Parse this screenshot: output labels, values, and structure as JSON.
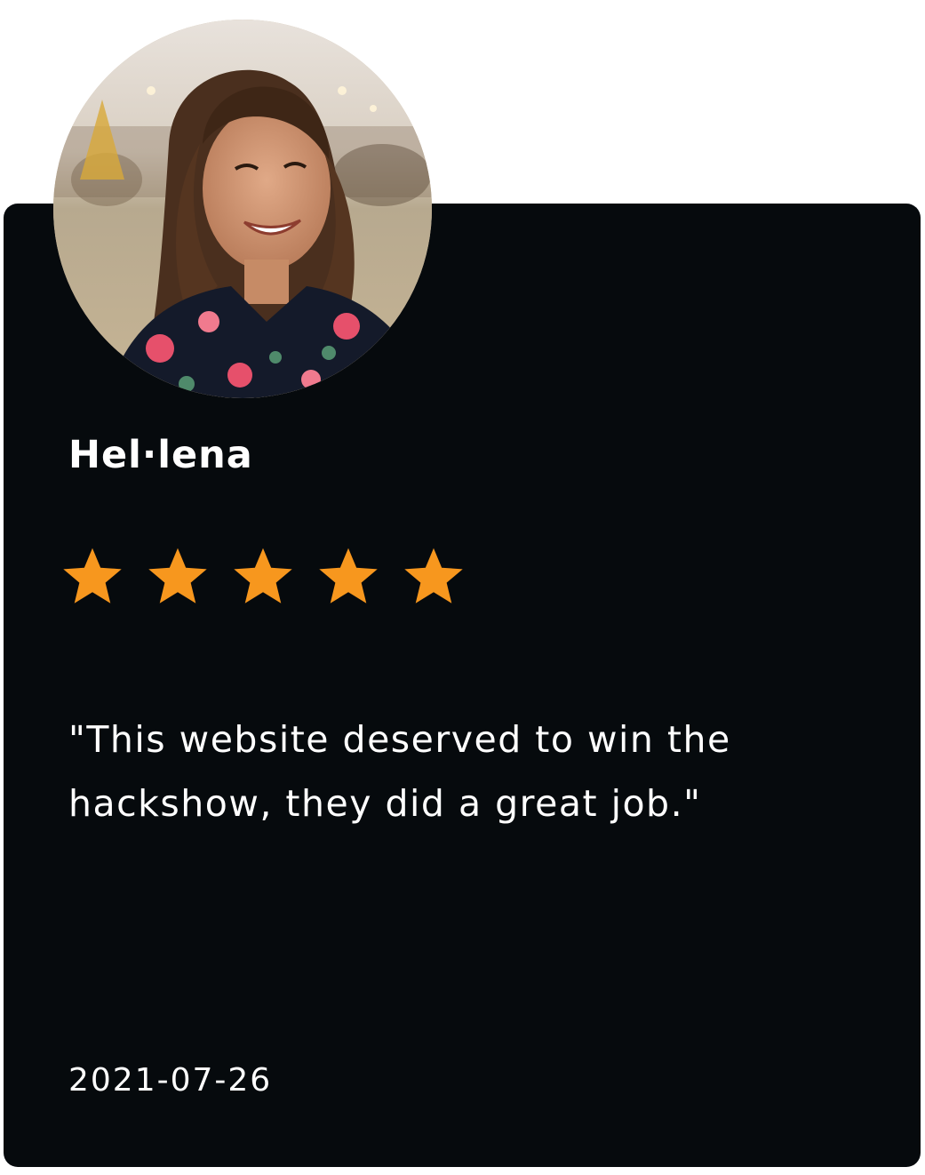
{
  "review": {
    "name": "Hel·lena",
    "rating": 5,
    "rating_max": 5,
    "quote": "\"This website deserved to win the hackshow, they did a great job.\"",
    "date": "2021-07-26"
  },
  "colors": {
    "card_background": "#060a0d",
    "star": "#f7971e",
    "text": "#ffffff"
  },
  "icons": {
    "rating": "star-icon"
  }
}
